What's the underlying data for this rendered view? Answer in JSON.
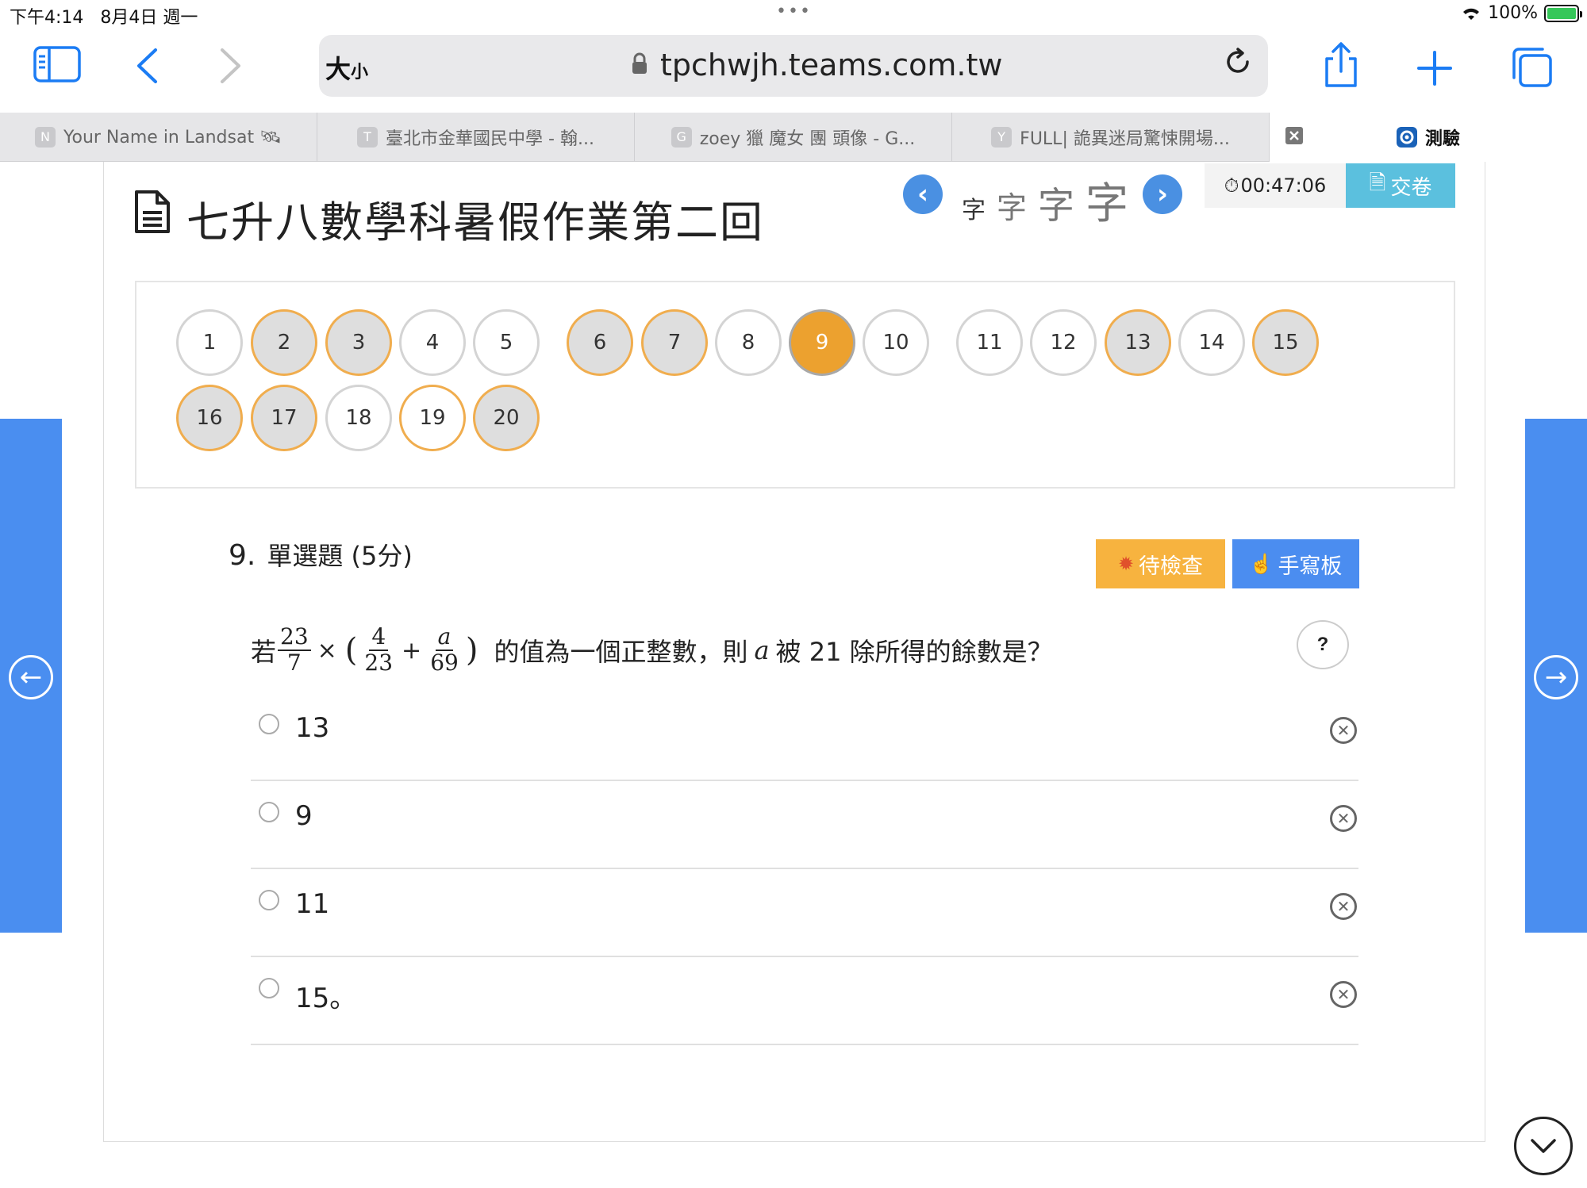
{
  "status": {
    "time": "下午4:14",
    "date": "8月4日 週一",
    "dots": "•••",
    "battery": "100%"
  },
  "browser": {
    "size_label_big": "大",
    "size_label_small": "小",
    "url": "tpchwjh.teams.com.tw",
    "tabs": [
      {
        "favicon": "N",
        "title": "Your Name in Landsat 🛰"
      },
      {
        "favicon": "T",
        "title": "臺北市金華國民中學 - 翰..."
      },
      {
        "favicon": "G",
        "title": "zoey 獵 魔女 團 頭像 - G..."
      },
      {
        "favicon": "Y",
        "title": "FULL| 詭異迷局驚悚開場..."
      },
      {
        "favicon": "",
        "title": "測驗"
      }
    ]
  },
  "page": {
    "title": "七升八數學科暑假作業第二回",
    "font_sizes": [
      "字",
      "字",
      "字",
      "字"
    ],
    "timer": "00:47:06",
    "submit_label": "交卷"
  },
  "question_nav": [
    {
      "n": "1",
      "state": "unanswered"
    },
    {
      "n": "2",
      "state": "answered"
    },
    {
      "n": "3",
      "state": "answered"
    },
    {
      "n": "4",
      "state": "unanswered"
    },
    {
      "n": "5",
      "state": "unanswered"
    },
    {
      "n": "6",
      "state": "answered"
    },
    {
      "n": "7",
      "state": "answered"
    },
    {
      "n": "8",
      "state": "unanswered"
    },
    {
      "n": "9",
      "state": "current"
    },
    {
      "n": "10",
      "state": "unanswered"
    },
    {
      "n": "11",
      "state": "unanswered"
    },
    {
      "n": "12",
      "state": "unanswered"
    },
    {
      "n": "13",
      "state": "answered"
    },
    {
      "n": "14",
      "state": "unanswered"
    },
    {
      "n": "15",
      "state": "answered"
    },
    {
      "n": "16",
      "state": "answered"
    },
    {
      "n": "17",
      "state": "answered"
    },
    {
      "n": "18",
      "state": "unanswered"
    },
    {
      "n": "19",
      "state": "flagged"
    },
    {
      "n": "20",
      "state": "answered"
    }
  ],
  "question": {
    "number": "9.",
    "type": "單選題 (5分)",
    "pending_label": "待檢查",
    "board_label": "手寫板",
    "help_label": "?",
    "prefix": "若",
    "frac1_num": "23",
    "frac1_den": "7",
    "times": "×",
    "paren_open": "(",
    "frac2_num": "4",
    "frac2_den": "23",
    "plus": "+",
    "frac3_num": "a",
    "frac3_den": "69",
    "paren_close": ")",
    "text_mid": "的值為一個正整數，則",
    "var": "a",
    "text_end": "被 21 除所得的餘數是？",
    "options": [
      "13",
      "9",
      "11",
      "15。"
    ]
  },
  "colors": {
    "accent_blue": "#4a8ef0",
    "answered_border": "#f0ad4e",
    "current_fill": "#eca12f",
    "pending_button": "#f7b33f",
    "submit_button": "#5bc0de"
  }
}
